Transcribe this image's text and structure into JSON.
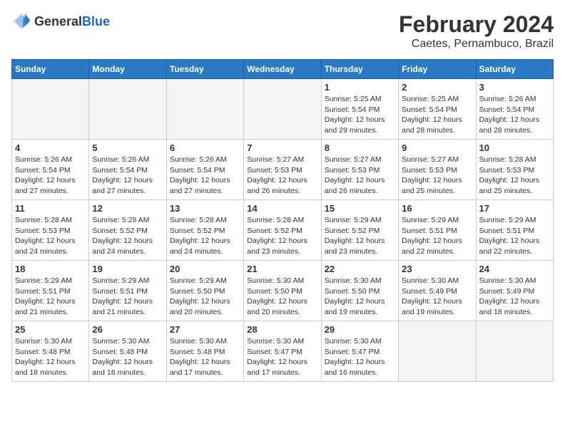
{
  "header": {
    "logo_general": "General",
    "logo_blue": "Blue",
    "month_year": "February 2024",
    "location": "Caetes, Pernambuco, Brazil"
  },
  "weekdays": [
    "Sunday",
    "Monday",
    "Tuesday",
    "Wednesday",
    "Thursday",
    "Friday",
    "Saturday"
  ],
  "weeks": [
    [
      {
        "day": "",
        "info": ""
      },
      {
        "day": "",
        "info": ""
      },
      {
        "day": "",
        "info": ""
      },
      {
        "day": "",
        "info": ""
      },
      {
        "day": "1",
        "info": "Sunrise: 5:25 AM\nSunset: 5:54 PM\nDaylight: 12 hours\nand 29 minutes."
      },
      {
        "day": "2",
        "info": "Sunrise: 5:25 AM\nSunset: 5:54 PM\nDaylight: 12 hours\nand 28 minutes."
      },
      {
        "day": "3",
        "info": "Sunrise: 5:26 AM\nSunset: 5:54 PM\nDaylight: 12 hours\nand 28 minutes."
      }
    ],
    [
      {
        "day": "4",
        "info": "Sunrise: 5:26 AM\nSunset: 5:54 PM\nDaylight: 12 hours\nand 27 minutes."
      },
      {
        "day": "5",
        "info": "Sunrise: 5:26 AM\nSunset: 5:54 PM\nDaylight: 12 hours\nand 27 minutes."
      },
      {
        "day": "6",
        "info": "Sunrise: 5:26 AM\nSunset: 5:54 PM\nDaylight: 12 hours\nand 27 minutes."
      },
      {
        "day": "7",
        "info": "Sunrise: 5:27 AM\nSunset: 5:53 PM\nDaylight: 12 hours\nand 26 minutes."
      },
      {
        "day": "8",
        "info": "Sunrise: 5:27 AM\nSunset: 5:53 PM\nDaylight: 12 hours\nand 26 minutes."
      },
      {
        "day": "9",
        "info": "Sunrise: 5:27 AM\nSunset: 5:53 PM\nDaylight: 12 hours\nand 25 minutes."
      },
      {
        "day": "10",
        "info": "Sunrise: 5:28 AM\nSunset: 5:53 PM\nDaylight: 12 hours\nand 25 minutes."
      }
    ],
    [
      {
        "day": "11",
        "info": "Sunrise: 5:28 AM\nSunset: 5:53 PM\nDaylight: 12 hours\nand 24 minutes."
      },
      {
        "day": "12",
        "info": "Sunrise: 5:28 AM\nSunset: 5:52 PM\nDaylight: 12 hours\nand 24 minutes."
      },
      {
        "day": "13",
        "info": "Sunrise: 5:28 AM\nSunset: 5:52 PM\nDaylight: 12 hours\nand 24 minutes."
      },
      {
        "day": "14",
        "info": "Sunrise: 5:28 AM\nSunset: 5:52 PM\nDaylight: 12 hours\nand 23 minutes."
      },
      {
        "day": "15",
        "info": "Sunrise: 5:29 AM\nSunset: 5:52 PM\nDaylight: 12 hours\nand 23 minutes."
      },
      {
        "day": "16",
        "info": "Sunrise: 5:29 AM\nSunset: 5:51 PM\nDaylight: 12 hours\nand 22 minutes."
      },
      {
        "day": "17",
        "info": "Sunrise: 5:29 AM\nSunset: 5:51 PM\nDaylight: 12 hours\nand 22 minutes."
      }
    ],
    [
      {
        "day": "18",
        "info": "Sunrise: 5:29 AM\nSunset: 5:51 PM\nDaylight: 12 hours\nand 21 minutes."
      },
      {
        "day": "19",
        "info": "Sunrise: 5:29 AM\nSunset: 5:51 PM\nDaylight: 12 hours\nand 21 minutes."
      },
      {
        "day": "20",
        "info": "Sunrise: 5:29 AM\nSunset: 5:50 PM\nDaylight: 12 hours\nand 20 minutes."
      },
      {
        "day": "21",
        "info": "Sunrise: 5:30 AM\nSunset: 5:50 PM\nDaylight: 12 hours\nand 20 minutes."
      },
      {
        "day": "22",
        "info": "Sunrise: 5:30 AM\nSunset: 5:50 PM\nDaylight: 12 hours\nand 19 minutes."
      },
      {
        "day": "23",
        "info": "Sunrise: 5:30 AM\nSunset: 5:49 PM\nDaylight: 12 hours\nand 19 minutes."
      },
      {
        "day": "24",
        "info": "Sunrise: 5:30 AM\nSunset: 5:49 PM\nDaylight: 12 hours\nand 18 minutes."
      }
    ],
    [
      {
        "day": "25",
        "info": "Sunrise: 5:30 AM\nSunset: 5:48 PM\nDaylight: 12 hours\nand 18 minutes."
      },
      {
        "day": "26",
        "info": "Sunrise: 5:30 AM\nSunset: 5:48 PM\nDaylight: 12 hours\nand 18 minutes."
      },
      {
        "day": "27",
        "info": "Sunrise: 5:30 AM\nSunset: 5:48 PM\nDaylight: 12 hours\nand 17 minutes."
      },
      {
        "day": "28",
        "info": "Sunrise: 5:30 AM\nSunset: 5:47 PM\nDaylight: 12 hours\nand 17 minutes."
      },
      {
        "day": "29",
        "info": "Sunrise: 5:30 AM\nSunset: 5:47 PM\nDaylight: 12 hours\nand 16 minutes."
      },
      {
        "day": "",
        "info": ""
      },
      {
        "day": "",
        "info": ""
      }
    ]
  ]
}
